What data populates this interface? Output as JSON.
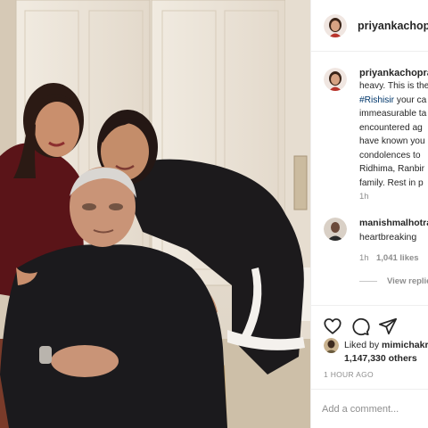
{
  "post": {
    "author": "priyankachopra"
  },
  "caption": {
    "author": "priyankachopra",
    "lines": [
      "heavy. This is the",
      "your ca",
      "immeasurable ta",
      "encountered ag",
      "have known you",
      "condolences to",
      "Ridhima, Ranbir",
      "family. Rest in p"
    ],
    "hashtag": "#Rishisir",
    "age": "1h"
  },
  "comments": [
    {
      "author": "manishmalhotra",
      "text": "heartbreaking",
      "age": "1h",
      "likes": "1,041 likes"
    }
  ],
  "view_replies": "View replie",
  "actions": {
    "like_icon": "heart-icon",
    "comment_icon": "comment-icon",
    "share_icon": "share-icon"
  },
  "liked_by": {
    "prefix": "Liked by",
    "user": "mimichakr",
    "count": "1,147,330 others"
  },
  "time_ago": "1 HOUR AGO",
  "add_comment": {
    "placeholder": "Add a comment..."
  },
  "colors": {
    "hashtag": "#00376b",
    "muted": "#8e8e8e",
    "border": "#efefef"
  }
}
